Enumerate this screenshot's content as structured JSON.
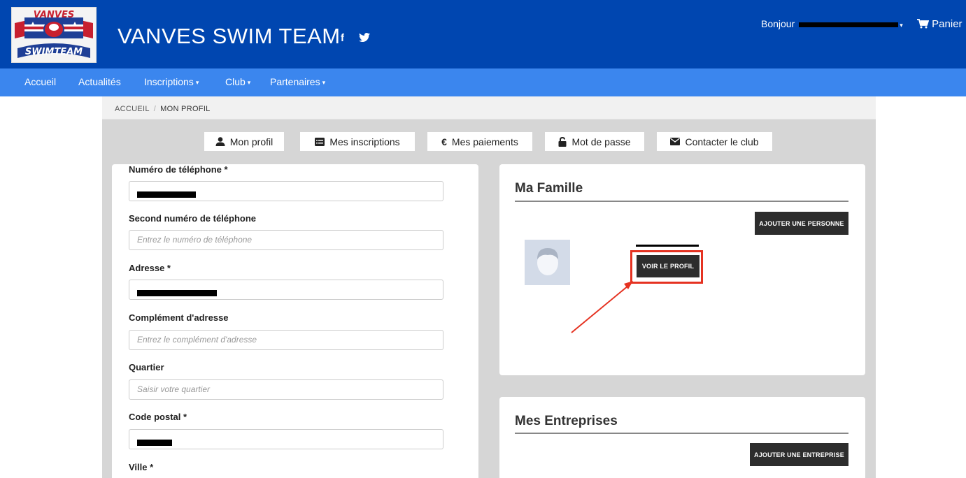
{
  "header": {
    "logo_text": "VANVES SWIMTEAM",
    "site_title": "VANVES SWIM TEAM",
    "social": [
      "facebook-icon",
      "twitter-icon"
    ],
    "greeting": "Bonjour",
    "cart_label": "Panier",
    "bg_color": "#0046b0"
  },
  "nav": {
    "items": [
      {
        "label": "Accueil",
        "dropdown": false
      },
      {
        "label": "Actualités",
        "dropdown": false
      },
      {
        "label": "Inscriptions",
        "dropdown": true
      },
      {
        "label": "Club",
        "dropdown": true
      },
      {
        "label": "Partenaires",
        "dropdown": true
      }
    ],
    "bg_color": "#3b86ee"
  },
  "breadcrumb": {
    "home": "ACCUEIL",
    "separator": "/",
    "current": "MON PROFIL"
  },
  "tabs": [
    {
      "label": "Mon profil",
      "icon": "user-icon"
    },
    {
      "label": "Mes inscriptions",
      "icon": "list-icon"
    },
    {
      "label": "Mes paiements",
      "icon": "euro-icon"
    },
    {
      "label": "Mot de passe",
      "icon": "lock-icon"
    },
    {
      "label": "Contacter le club",
      "icon": "envelope-icon"
    }
  ],
  "form": {
    "phone": {
      "label": "Numéro de téléphone *",
      "value": "[redacted]"
    },
    "phone2": {
      "label": "Second numéro de téléphone",
      "placeholder": "Entrez le numéro de téléphone"
    },
    "address": {
      "label": "Adresse *",
      "value": "[redacted]"
    },
    "address2": {
      "label": "Complément d'adresse",
      "placeholder": "Entrez le complément d'adresse"
    },
    "district": {
      "label": "Quartier",
      "placeholder": "Saisir votre quartier"
    },
    "postcode": {
      "label": "Code postal *",
      "value": "[redacted]"
    },
    "city": {
      "label": "Ville *"
    }
  },
  "family": {
    "title": "Ma Famille",
    "add_button": "AJOUTER UNE PERSONNE",
    "member": {
      "name": "[redacted]",
      "view_button": "VOIR LE PROFIL"
    },
    "highlight_color": "#e53221"
  },
  "companies": {
    "title": "Mes Entreprises",
    "add_button": "AJOUTER UNE ENTREPRISE"
  }
}
